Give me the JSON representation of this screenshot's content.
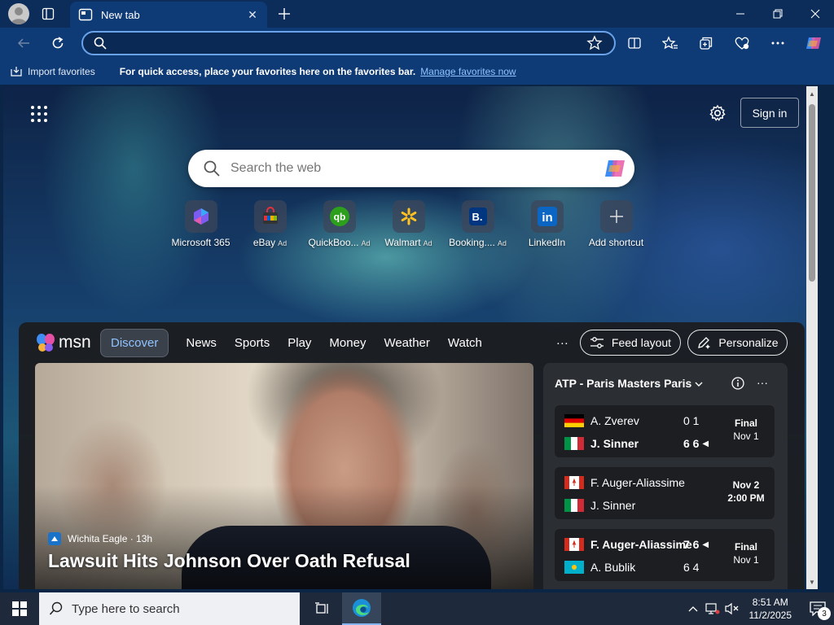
{
  "browser": {
    "tab": {
      "title": "New tab"
    },
    "address": {
      "value": "",
      "placeholder": ""
    },
    "favorites_bar": {
      "import_label": "Import favorites",
      "message": "For quick access, place your favorites here on the favorites bar.",
      "manage_link": "Manage favorites now"
    }
  },
  "newtab": {
    "sign_in_label": "Sign in",
    "search_placeholder": "Search the web",
    "shortcuts": [
      {
        "label": "Microsoft 365",
        "ad": "",
        "icon": "microsoft365-icon"
      },
      {
        "label": "eBay",
        "ad": "Ad",
        "icon": "ebay-icon"
      },
      {
        "label": "QuickBoo...",
        "ad": "Ad",
        "icon": "quickbooks-icon"
      },
      {
        "label": "Walmart",
        "ad": "Ad",
        "icon": "walmart-icon"
      },
      {
        "label": "Booking....",
        "ad": "Ad",
        "icon": "booking-icon"
      },
      {
        "label": "LinkedIn",
        "ad": "",
        "icon": "linkedin-icon"
      },
      {
        "label": "Add shortcut",
        "ad": "",
        "icon": "plus-icon"
      }
    ]
  },
  "feed": {
    "logo_text": "msn",
    "tabs": [
      "Discover",
      "News",
      "Sports",
      "Play",
      "Money",
      "Weather",
      "Watch"
    ],
    "more_label": "···",
    "feed_layout_label": "Feed layout",
    "personalize_label": "Personalize",
    "hero": {
      "source": "Wichita Eagle · 13h",
      "title": "Lawsuit Hits Johnson Over Oath Refusal"
    },
    "sports": {
      "header": "ATP - Paris Masters Paris",
      "matches": [
        {
          "p1": "A. Zverev",
          "p1_flag": "germany",
          "p1_score": "0 1",
          "p2": "J. Sinner",
          "p2_flag": "italy",
          "p2_score": "6 6",
          "status_line1": "Final",
          "status_line2": "Nov 1",
          "p1_bold": false,
          "p2_bold": true
        },
        {
          "p1": "F. Auger-Aliassime",
          "p1_flag": "canada",
          "p1_score": "",
          "p2": "J. Sinner",
          "p2_flag": "italy",
          "p2_score": "",
          "status_line1": "Nov 2",
          "status_line2": "2:00 PM",
          "p1_bold": false,
          "p2_bold": false
        },
        {
          "p1": "F. Auger-Aliassime",
          "p1_flag": "canada",
          "p1_score": "7 6",
          "p2": "A. Bublik",
          "p2_flag": "kazakhstan",
          "p2_score": "6 4",
          "status_line1": "Final",
          "status_line2": "Nov 1",
          "p1_bold": true,
          "p2_bold": false
        }
      ]
    }
  },
  "taskbar": {
    "search_placeholder": "Type here to search",
    "time": "8:51 AM",
    "date": "11/2/2025",
    "notification_count": "3"
  },
  "colors": {
    "titlebar": "#0c2d5a",
    "toolbar": "#0e3a75",
    "accent_link": "#8fc3ff",
    "feed_bg": "#1c1e22",
    "taskbar": "#1e2a3c"
  }
}
